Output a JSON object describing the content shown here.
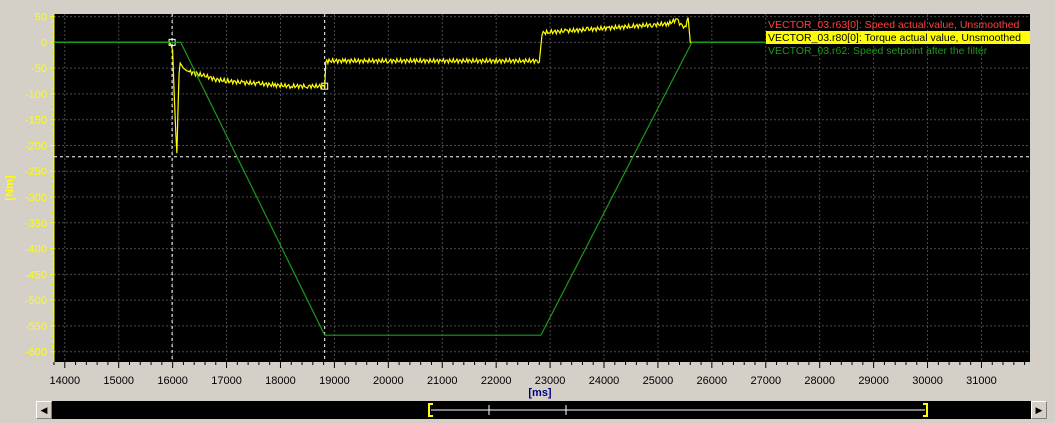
{
  "chart_data": {
    "type": "line",
    "xlabel": "[ms]",
    "ylabel": "[Nm]",
    "xlim": [
      13800,
      31900
    ],
    "ylim": [
      -620,
      55
    ],
    "x_ticks": [
      14000,
      15000,
      16000,
      17000,
      18000,
      19000,
      20000,
      21000,
      22000,
      23000,
      24000,
      25000,
      26000,
      27000,
      28000,
      29000,
      30000,
      31000
    ],
    "y_ticks": [
      50,
      0,
      -50,
      -100,
      -150,
      -200,
      -250,
      -300,
      -350,
      -400,
      -450,
      -500,
      -550,
      -600
    ],
    "grid": true,
    "legend_position": "top-right",
    "cursor_lines": {
      "vertical": [
        15990,
        18820
      ],
      "horizontal": [
        -222
      ]
    },
    "series": [
      {
        "name": "VECTOR_03.r63[0]: Speed actual value, Unsmoothed",
        "color": "#ff4040",
        "x": [],
        "y": []
      },
      {
        "name": "VECTOR_03.r80[0]: Torque actual value, Unsmoothed",
        "color": "#ffff00",
        "x": [
          13800,
          15950,
          16000,
          16030,
          16060,
          16080,
          16100,
          16120,
          16140,
          16170,
          16200,
          16260,
          16400,
          16600,
          16800,
          17000,
          17300,
          17600,
          17900,
          18200,
          18500,
          18820,
          18840,
          18900,
          19200,
          19600,
          20000,
          20500,
          21000,
          21500,
          22000,
          22500,
          22800,
          22850,
          23000,
          23300,
          23700,
          24100,
          24500,
          24900,
          25200,
          25350,
          25450,
          25500,
          25560,
          25600,
          25650,
          26000,
          27000,
          28000,
          29000,
          30000,
          31000,
          31900
        ],
        "y": [
          0,
          0,
          -15,
          -100,
          -180,
          -215,
          -130,
          -60,
          -40,
          -45,
          -50,
          -55,
          -60,
          -65,
          -72,
          -75,
          -78,
          -80,
          -83,
          -85,
          -85,
          -85,
          -38,
          -36,
          -36,
          -36,
          -36,
          -36,
          -36,
          -36,
          -36,
          -36,
          -36,
          18,
          20,
          22,
          25,
          28,
          31,
          34,
          36,
          45,
          30,
          28,
          48,
          0,
          0,
          0,
          0,
          0,
          0,
          0,
          0,
          0
        ]
      },
      {
        "name": "VECTOR_03.r62: Speed setpoint after the filter",
        "color": "#1a9a1a",
        "x": [
          13800,
          16150,
          18820,
          22830,
          25630,
          31900
        ],
        "y": [
          0,
          0,
          -568,
          -568,
          0,
          0
        ]
      }
    ]
  }
}
